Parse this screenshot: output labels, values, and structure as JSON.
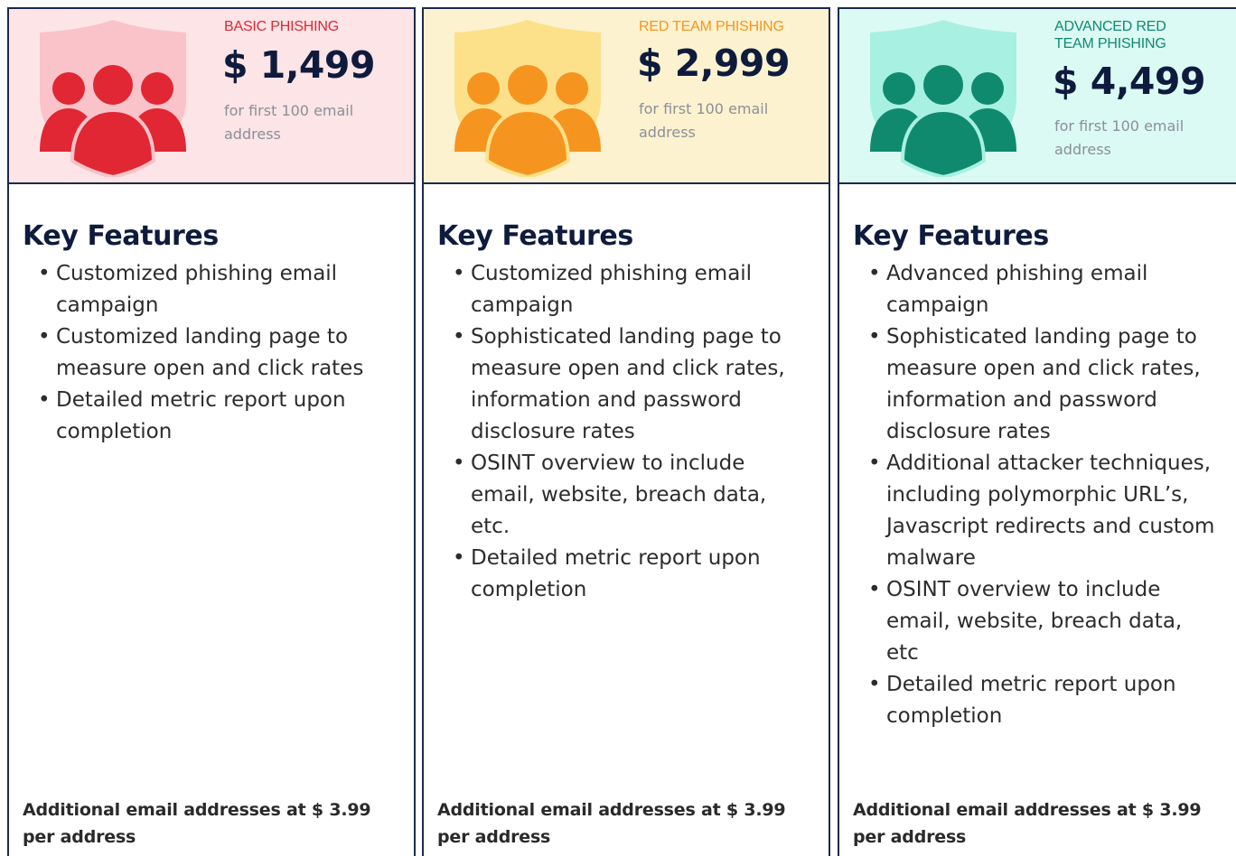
{
  "plans": [
    {
      "tier": "BASIC PHISHING",
      "price": "$ 1,499",
      "price_note": "for first 100 email address",
      "features_title": "Key Features",
      "features": [
        "Customized phishing email campaign",
        "Customized landing page to measure open and click rates",
        "Detailed metric report upon completion"
      ],
      "footer": "Additional email addresses at $ 3.99 per address",
      "colors": {
        "header_bg": "#fde4e6",
        "accent": "#e02733",
        "shield": "#f9c3c9"
      }
    },
    {
      "tier": "RED TEAM PHISHING",
      "price": "$ 2,999",
      "price_note": "for first 100 email address",
      "features_title": "Key Features",
      "features": [
        "Customized phishing email campaign",
        "Sophisticated landing page to measure open and click rates, information and password disclosure rates",
        "OSINT overview to include email, website, breach data, etc.",
        "Detailed metric report upon completion"
      ],
      "footer": "Additional email addresses at $ 3.99 per address",
      "colors": {
        "header_bg": "#fdf2cf",
        "accent": "#f5951f",
        "shield": "#fde08a"
      }
    },
    {
      "tier": "ADVANCED RED TEAM PHISHING",
      "price": "$ 4,499",
      "price_note": "for first 100 email address",
      "features_title": "Key Features",
      "features": [
        "Advanced phishing email campaign",
        "Sophisticated landing page to measure open and click rates, information and password disclosure rates",
        "Additional attacker techniques, including polymorphic URL’s, Javascript redirects and custom malware",
        "OSINT overview to include email, website, breach data, etc",
        "Detailed metric report upon completion"
      ],
      "footer": "Additional email addresses at $ 3.99 per address",
      "colors": {
        "header_bg": "#dcfaf4",
        "accent": "#0f8a6e",
        "shield": "#a8f0e2"
      }
    }
  ],
  "icons": [
    "shield-people-icon"
  ]
}
